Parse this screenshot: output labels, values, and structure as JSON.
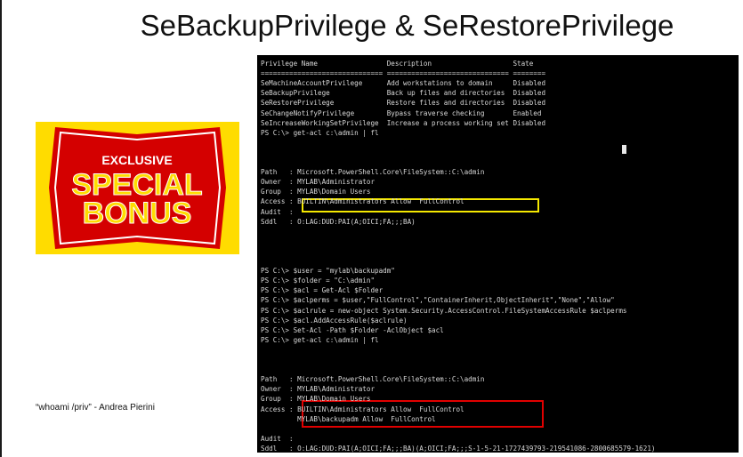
{
  "title": "SeBackupPrivilege & SeRestorePrivilege",
  "badge": {
    "line1": "EXCLUSIVE",
    "line2": "SPECIAL",
    "line3": "BONUS"
  },
  "credit": "“whoami /priv” - Andrea Pierini",
  "colors": {
    "badge_bg": "#ffdc00",
    "badge_red": "#d40000",
    "highlight_yellow": "#f5e800",
    "highlight_red": "#e00000"
  },
  "terminal": {
    "lines": [
      "Privilege Name                 Description                    State",
      "============================== ============================== ========",
      "SeMachineAccountPrivilege      Add workstations to domain     Disabled",
      "SeBackupPrivilege              Back up files and directories  Disabled",
      "SeRestorePrivilege             Restore files and directories  Disabled",
      "SeChangeNotifyPrivilege        Bypass traverse checking       Enabled",
      "SeIncreaseWorkingSetPrivilege  Increase a process working set Disabled",
      "PS C:\\> get-acl c:\\admin | fl",
      "",
      "",
      "",
      "Path   : Microsoft.PowerShell.Core\\FileSystem::C:\\admin",
      "Owner  : MYLAB\\Administrator",
      "Group  : MYLAB\\Domain Users",
      "Access : BUILTIN\\Administrators Allow  FullControl",
      "Audit  :",
      "Sddl   : O:LAG:DUD:PAI(A;OICI;FA;;;BA)",
      "",
      "",
      "",
      "",
      "PS C:\\> $user = \"mylab\\backupadm\"",
      "PS C:\\> $folder = \"C:\\admin\"",
      "PS C:\\> $acl = Get-Acl $Folder",
      "PS C:\\> $aclperms = $user,\"FullControl\",\"ContainerInherit,ObjectInherit\",\"None\",\"Allow\"",
      "PS C:\\> $aclrule = new-object System.Security.AccessControl.FileSystemAccessRule $aclperms",
      "PS C:\\> $acl.AddAccessRule($aclrule)",
      "PS C:\\> Set-Acl -Path $Folder -AclObject $acl",
      "PS C:\\> get-acl c:\\admin | fl",
      "",
      "",
      "",
      "Path   : Microsoft.PowerShell.Core\\FileSystem::C:\\admin",
      "Owner  : MYLAB\\Administrator",
      "Group  : MYLAB\\Domain Users",
      "Access : BUILTIN\\Administrators Allow  FullControl",
      "         MYLAB\\backupadm Allow  FullControl",
      "",
      "Audit  :",
      "Sddl   : O:LAG:DUD:PAI(A;OICI;FA;;;BA)(A;OICI;FA;;;S-1-5-21-1727439793-219541086-2800685579-1621)"
    ]
  }
}
